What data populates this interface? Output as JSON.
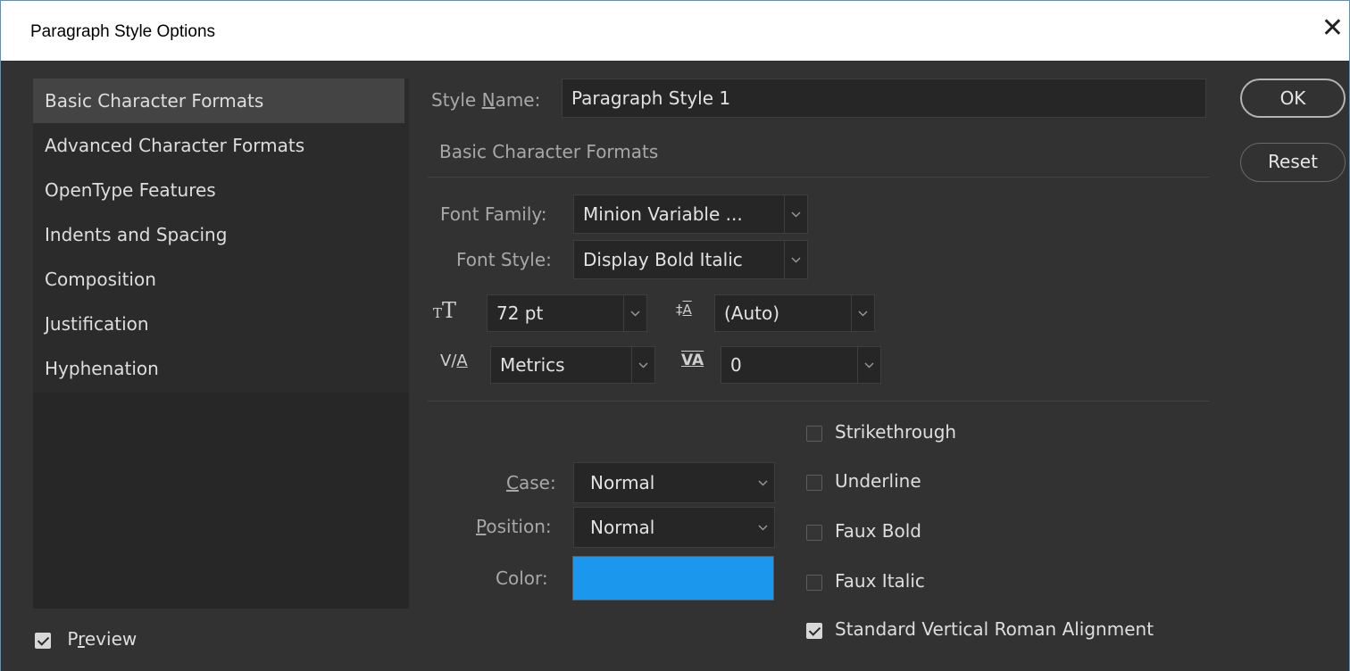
{
  "window": {
    "title": "Paragraph Style Options",
    "close_glyph": "✕"
  },
  "sidebar": {
    "items": [
      {
        "label": "Basic Character Formats",
        "selected": true
      },
      {
        "label": "Advanced Character Formats",
        "selected": false
      },
      {
        "label": "OpenType Features",
        "selected": false
      },
      {
        "label": "Indents and Spacing",
        "selected": false
      },
      {
        "label": "Composition",
        "selected": false
      },
      {
        "label": "Justification",
        "selected": false
      },
      {
        "label": "Hyphenation",
        "selected": false
      }
    ]
  },
  "preview": {
    "label_pre": "P",
    "label_u": "r",
    "label_post": "eview",
    "checked": true
  },
  "style_name": {
    "label_pre": "Style ",
    "label_u": "N",
    "label_post": "ame:",
    "value": "Paragraph Style 1"
  },
  "section_title": "Basic Character Formats",
  "font_family": {
    "label": "Font Family:",
    "value": "Minion Variable ..."
  },
  "font_style": {
    "label": "Font Style:",
    "value": "Display Bold Italic"
  },
  "font_size": {
    "icon": "font-size-icon",
    "value": "72 pt"
  },
  "leading": {
    "icon": "leading-icon",
    "value": "(Auto)"
  },
  "kerning": {
    "icon": "kerning-icon",
    "value": "Metrics"
  },
  "tracking": {
    "icon": "tracking-icon",
    "value": "0"
  },
  "case": {
    "label_u": "C",
    "label_post": "ase:",
    "value": "Normal"
  },
  "position": {
    "label_u": "P",
    "label_post": "osition:",
    "value": "Normal"
  },
  "color": {
    "label": "Color:",
    "value": "#1b97ee"
  },
  "checkboxes": [
    {
      "label": "Strikethrough",
      "checked": false
    },
    {
      "label": "Underline",
      "checked": false
    },
    {
      "label": "Faux Bold",
      "checked": false
    },
    {
      "label": "Faux Italic",
      "checked": false
    },
    {
      "label": "Standard Vertical Roman Alignment",
      "checked": true
    }
  ],
  "buttons": {
    "ok": "OK",
    "reset": "Reset"
  }
}
